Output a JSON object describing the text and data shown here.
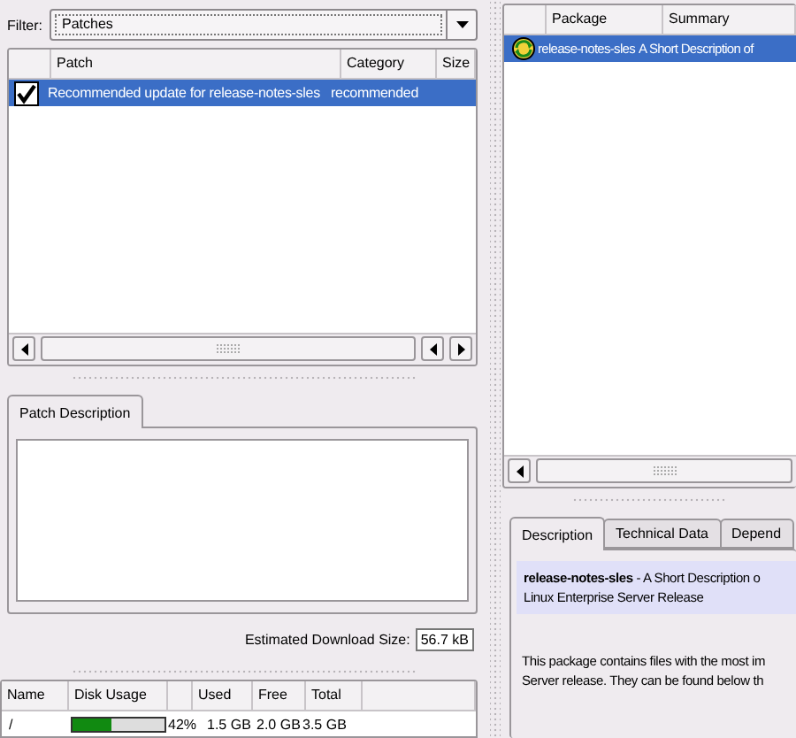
{
  "filter": {
    "label": "Filter:",
    "value": "Patches"
  },
  "patches": {
    "columns": [
      "Patch",
      "Category",
      "Size"
    ],
    "rows": [
      {
        "checked": true,
        "selected": true,
        "patch": "Recommended update for release-notes-sles",
        "category": "recommended"
      }
    ]
  },
  "patch_tabs": [
    {
      "label": "Patch Description",
      "selected": true
    }
  ],
  "download_size": {
    "label": "Estimated Download Size:",
    "value": "56.7 kB"
  },
  "disk": {
    "columns": [
      "Name",
      "Disk Usage",
      "",
      "Used",
      "Free",
      "Total"
    ],
    "rows": [
      {
        "name": "/",
        "level": 0.42,
        "percent": "42%",
        "used": "1.5 GB",
        "free": "2.0 GB",
        "total": "3.5 GB"
      }
    ]
  },
  "packages": {
    "columns": [
      "Package",
      "Summary"
    ],
    "rows": [
      {
        "selected": true,
        "package": "release-notes-sles",
        "summary": "A Short Description of"
      }
    ]
  },
  "detail_tabs": [
    {
      "label": "Description",
      "selected": true
    },
    {
      "label": "Technical Data",
      "selected": false
    },
    {
      "label": "Depend",
      "selected": false
    }
  ],
  "description": {
    "heading": [
      "**release-notes-sles** - A Short Description o",
      "Linux Enterprise Server Release"
    ],
    "body": [
      "This package contains files with the most im",
      "Server release. They can be found below th"
    ]
  }
}
